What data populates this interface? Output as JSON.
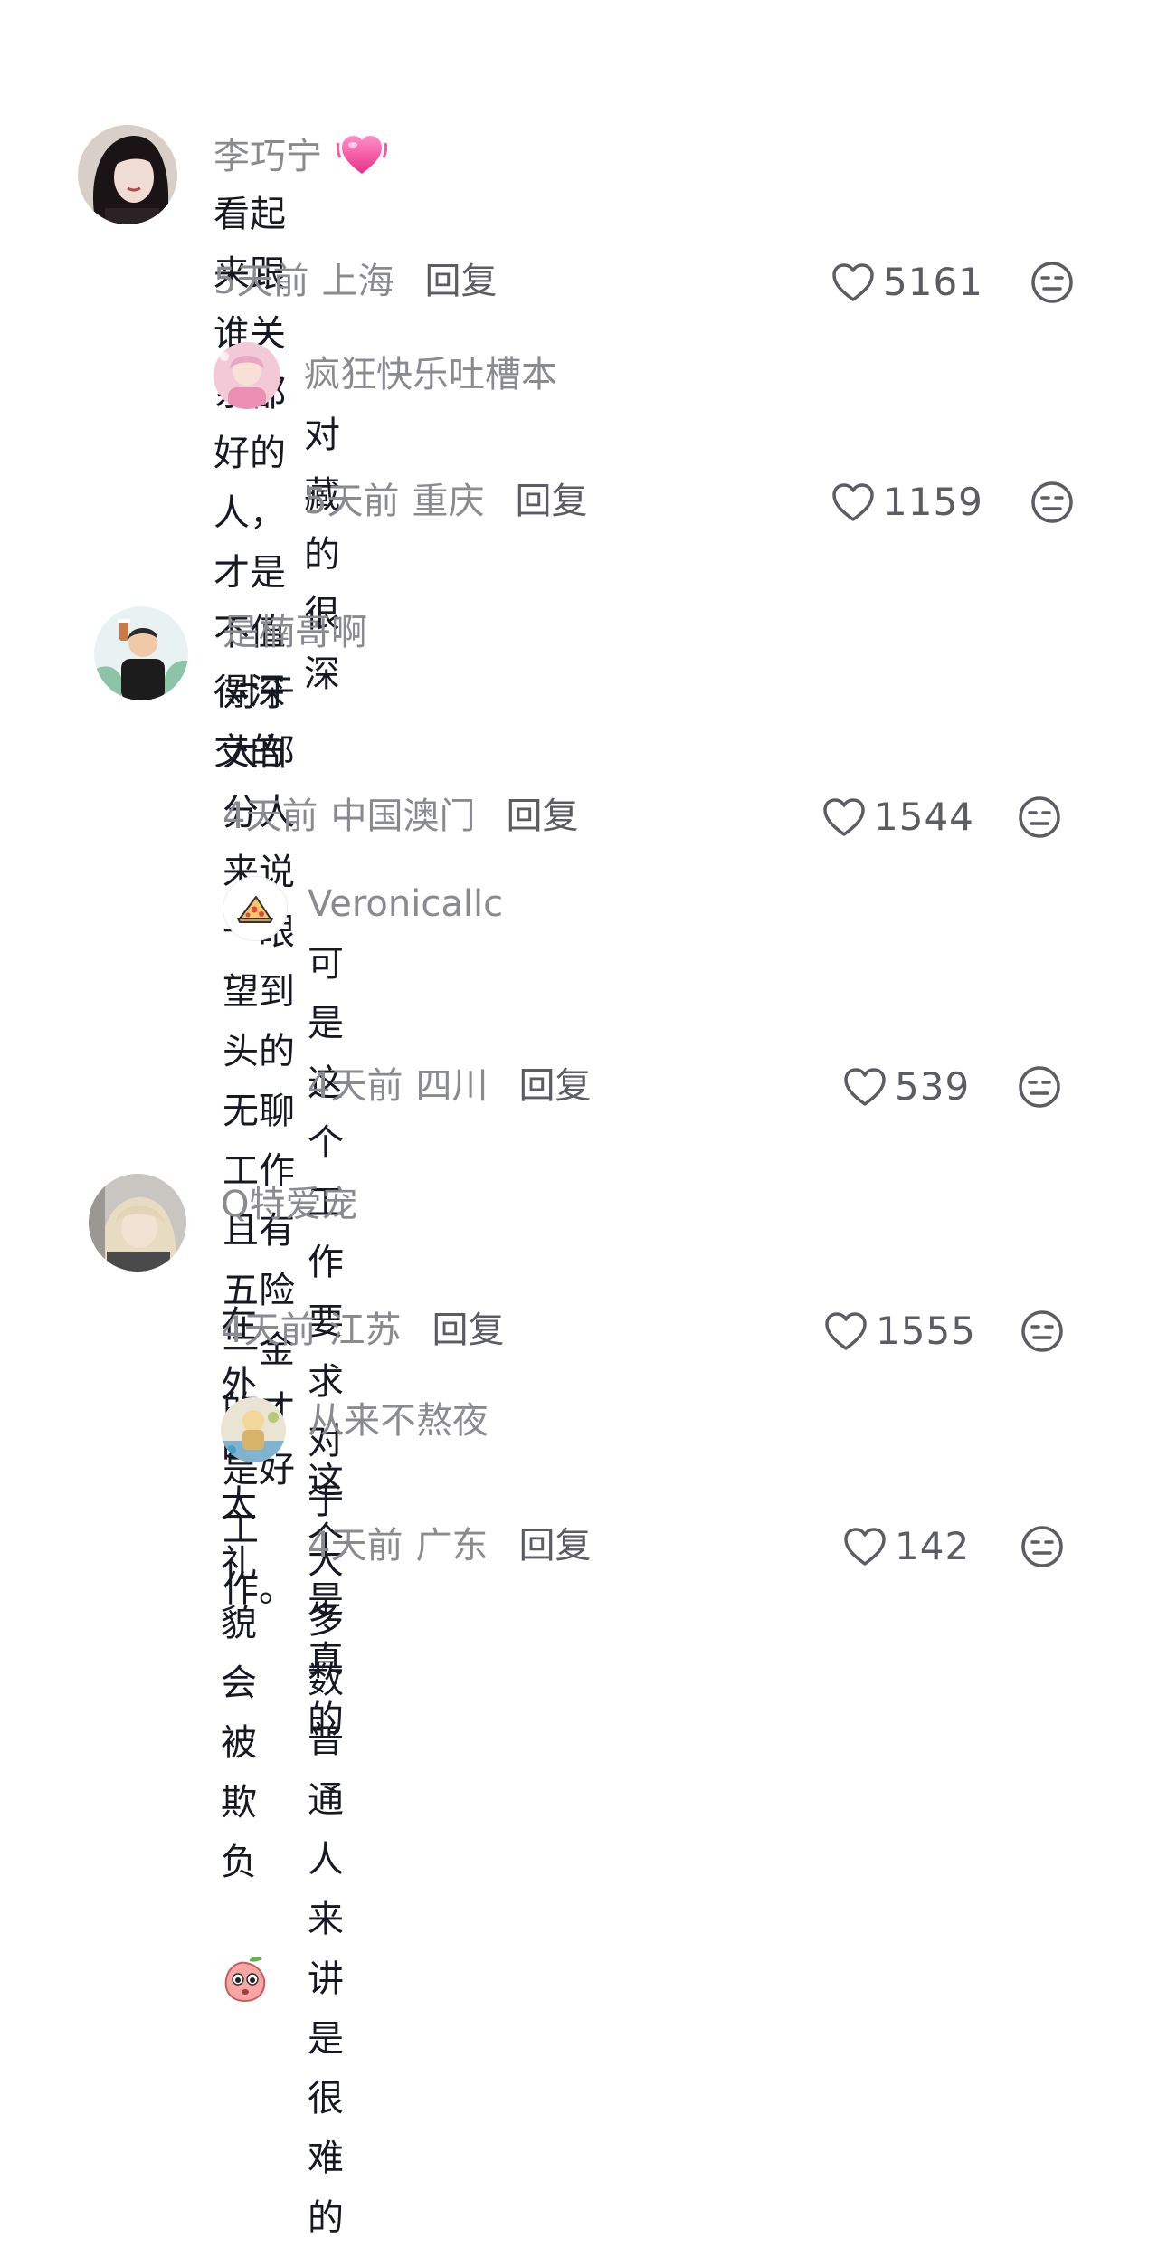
{
  "comments": [
    {
      "username": "李巧宁",
      "badge_icon": "pink-heart-icon",
      "text": "看起来跟谁关系都好的人，才是不值得深交的",
      "time": "5天前",
      "location": "上海",
      "reply_label": "回复",
      "likes": "5161",
      "avatar_icon": "avatar-woman-dark-hair"
    },
    {
      "username": "疯狂快乐吐槽本",
      "text": "对藏的很深",
      "time": "5天前",
      "location": "重庆",
      "reply_label": "回复",
      "likes": "1159",
      "avatar_icon": "avatar-pink-doll"
    },
    {
      "username": "是楠哥啊",
      "text": "对于大部分人来说一眼望到头的无聊工作且有五险\n一金的才是好工作。",
      "time": "4天前",
      "location": "中国澳门",
      "reply_label": "回复",
      "likes": "1544",
      "avatar_icon": "avatar-cartoon-man"
    },
    {
      "username": "Veronicallc",
      "text": "可是这个工作要求对于大多数普通人来讲是很\n难的",
      "time": "4天前",
      "location": "四川",
      "reply_label": "回复",
      "likes": "539",
      "avatar_icon": "avatar-pizza"
    },
    {
      "username": "Q特爱宠",
      "text": "在外面太礼貌会被欺负",
      "inline_emoji": "peach-face-emoji",
      "time": "4天前",
      "location": "江苏",
      "reply_label": "回复",
      "likes": "1555",
      "avatar_icon": "avatar-blond-person"
    },
    {
      "username": "从来不熬夜",
      "text": "这个是真的",
      "time": "4天前",
      "location": "广东",
      "reply_label": "回复",
      "likes": "142",
      "avatar_icon": "avatar-toy-figure"
    }
  ],
  "icons": {
    "like": "heart-outline-icon",
    "dislike": "meh-face-icon"
  },
  "colors": {
    "username": "#8a8b91",
    "text": "#161823",
    "meta": "#8a8b91",
    "reply": "#5c5d64"
  }
}
